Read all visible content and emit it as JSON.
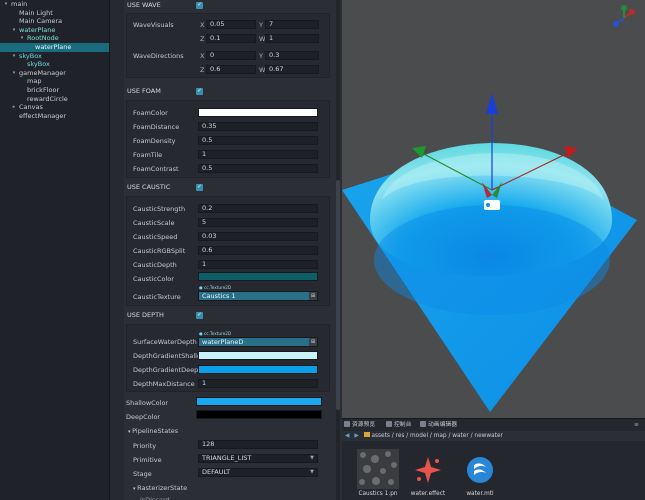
{
  "hierarchy": {
    "items": [
      {
        "label": "main",
        "arrow": "▾",
        "indent": 0,
        "cls": ""
      },
      {
        "label": "Main Light",
        "arrow": "",
        "indent": 1,
        "cls": ""
      },
      {
        "label": "Main Camera",
        "arrow": "",
        "indent": 1,
        "cls": ""
      },
      {
        "label": "waterPlane",
        "arrow": "▾",
        "indent": 1,
        "cls": "green"
      },
      {
        "label": "RootNode",
        "arrow": "▾",
        "indent": 2,
        "cls": "green"
      },
      {
        "label": "waterPlane",
        "arrow": "",
        "indent": 3,
        "cls": "sel"
      },
      {
        "label": "skyBox",
        "arrow": "▾",
        "indent": 1,
        "cls": "prefab"
      },
      {
        "label": "skyBox",
        "arrow": "",
        "indent": 2,
        "cls": "prefab"
      },
      {
        "label": "gameManager",
        "arrow": "▾",
        "indent": 1,
        "cls": ""
      },
      {
        "label": "map",
        "arrow": "",
        "indent": 2,
        "cls": ""
      },
      {
        "label": "brickFloor",
        "arrow": "",
        "indent": 2,
        "cls": ""
      },
      {
        "label": "rewardCircle",
        "arrow": "",
        "indent": 2,
        "cls": ""
      },
      {
        "label": "Canvas",
        "arrow": "▸",
        "indent": 1,
        "cls": ""
      },
      {
        "label": "effectManager",
        "arrow": "",
        "indent": 1,
        "cls": ""
      }
    ]
  },
  "inspector": {
    "use_wave": "USE WAVE",
    "wave_visuals": "WaveVisuals",
    "wave_visuals_vals": {
      "x": "0.05",
      "y": "7",
      "z": "0.1",
      "w": "1"
    },
    "wave_directions": "WaveDirections",
    "wave_directions_vals": {
      "x": "0",
      "y": "0.3",
      "z": "0.6",
      "w": "0.67"
    },
    "axes": {
      "x": "X",
      "y": "Y",
      "z": "Z",
      "w": "W"
    },
    "use_foam": "USE FOAM",
    "foam": {
      "color_label": "FoamColor",
      "distance_label": "FoamDistance",
      "distance": "0.35",
      "density_label": "FoamDensity",
      "density": "0.5",
      "tile_label": "FoamTile",
      "tile": "1",
      "contrast_label": "FoamContrast",
      "contrast": "0.5"
    },
    "use_caustic": "USE CAUSTIC",
    "caustic": {
      "strength_label": "CausticStrength",
      "strength": "0.2",
      "scale_label": "CausticScale",
      "scale": "5",
      "speed_label": "CausticSpeed",
      "speed": "0.03",
      "rgbsplit_label": "CausticRGBSplit",
      "rgbsplit": "0.6",
      "depth_label": "CausticDepth",
      "depth": "1",
      "color_label": "CausticColor",
      "texture_label": "CausticTexture",
      "texture_hint": "cc.Texture2D",
      "texture_value": "Caustics 1"
    },
    "use_depth": "USE DEPTH",
    "depth": {
      "surface_label": "SurfaceWaterDepth",
      "surface_hint": "cc.Texture2D",
      "surface_value": "waterPlaneD",
      "shallow_label": "DepthGradientShallow",
      "deep_label": "DepthGradientDeep",
      "maxdist_label": "DepthMaxDistance",
      "maxdist": "1"
    },
    "shallow_color_label": "ShallowColor",
    "deep_color_label": "DeepColor",
    "pipeline": {
      "title": "PipelineStates",
      "priority_label": "Priority",
      "priority": "128",
      "primitive_label": "Primitive",
      "primitive": "TRIANGLE_LIST",
      "stage_label": "Stage",
      "stage": "DEFAULT",
      "raster_label": "RasterizerState",
      "isdiscard_label": "isDiscard"
    },
    "colors": {
      "foam": "#ffffff",
      "caustic": "#0d5e66",
      "shallow": "#c8f4fa",
      "deep": "#0aa0e8",
      "shallow_color": "#1aa8f0",
      "deep_color": "#000000"
    }
  },
  "bottom": {
    "tabs": [
      "资源预览",
      "控制台",
      "动画编辑器"
    ],
    "path": "assets / res / model / map / water / newwater",
    "files": [
      {
        "name": "Caustics 1.pn",
        "icon": "texture-thumbnail"
      },
      {
        "name": "water.effect",
        "icon": "effect-icon"
      },
      {
        "name": "water.mtl",
        "icon": "material-icon"
      }
    ]
  }
}
